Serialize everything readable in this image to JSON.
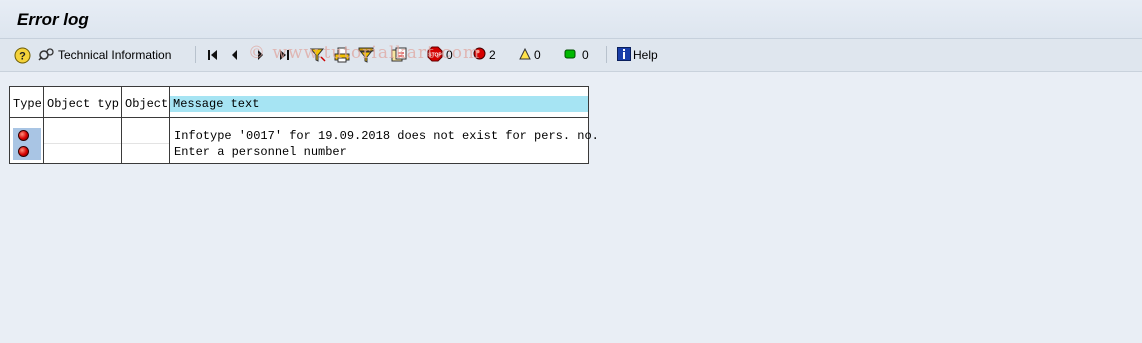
{
  "window": {
    "title": "Error log"
  },
  "toolbar": {
    "technical_info_label": "Technical Information",
    "stop_count": "0",
    "error_count": "2",
    "warning_count": "0",
    "success_count": "0",
    "help_label": "Help",
    "icons": [
      "help-question-icon",
      "technical-info-icon",
      "first-page-icon",
      "previous-icon",
      "next-icon",
      "last-page-icon",
      "filter-icon",
      "print-icon",
      "set-filter-icon",
      "export-icon",
      "stop-icon",
      "error-led-icon",
      "warning-triangle-icon",
      "success-led-icon",
      "info-icon"
    ]
  },
  "watermark": "© www.tutorialkart.com",
  "table": {
    "headers": [
      "Type",
      "Object typ",
      "Object",
      "Message text"
    ],
    "rows": [
      {
        "type": "error",
        "object_type": "",
        "object": "",
        "message": "Infotype '0017' for 19.09.2018 does not exist for pers. no."
      },
      {
        "type": "error",
        "object_type": "",
        "object": "",
        "message": "Enter a personnel number"
      }
    ]
  },
  "colors": {
    "header_bg": "#a6e4f3",
    "selected_cell": "#a9c5e4",
    "background": "#e9eef5",
    "error_red": "#d60000"
  }
}
